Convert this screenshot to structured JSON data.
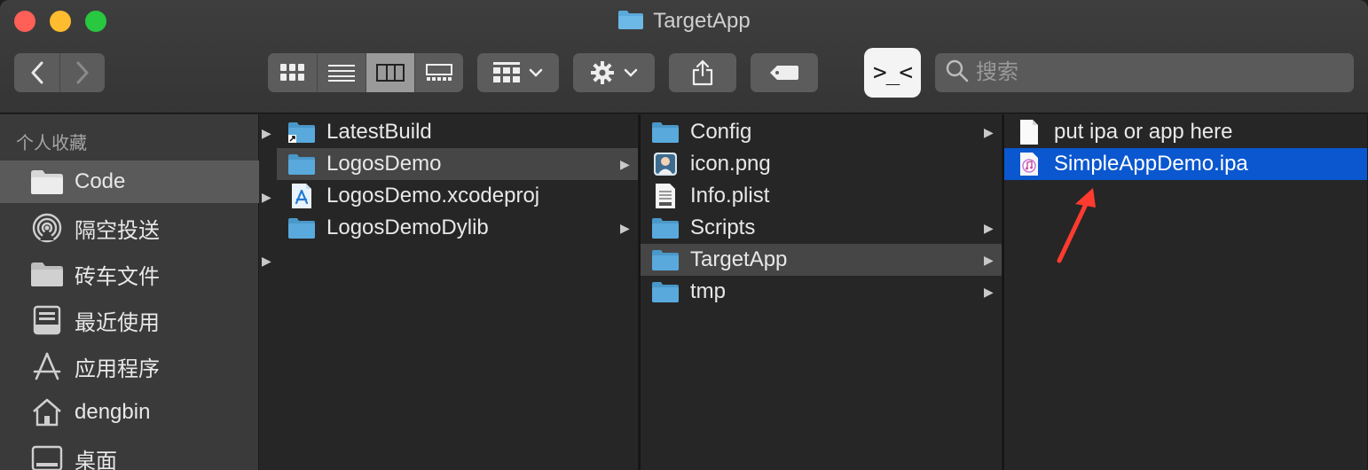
{
  "window": {
    "title": "TargetApp"
  },
  "toolbar": {
    "search_placeholder": "搜索",
    "terminal_label": ">_<"
  },
  "sidebar": {
    "section_title": "个人收藏",
    "items": [
      {
        "label": "Code",
        "icon": "folder-icon",
        "selected": true
      },
      {
        "label": "隔空投送",
        "icon": "airdrop-icon"
      },
      {
        "label": "砖车文件",
        "icon": "folder-icon"
      },
      {
        "label": "最近使用",
        "icon": "recents-icon"
      },
      {
        "label": "应用程序",
        "icon": "applications-icon"
      },
      {
        "label": "dengbin",
        "icon": "home-icon"
      },
      {
        "label": "桌面",
        "icon": "desktop-icon"
      }
    ]
  },
  "columns": [
    {
      "items": [
        {
          "label": "LatestBuild",
          "icon": "folder-alias-icon",
          "expandable": false
        },
        {
          "label": "LogosDemo",
          "icon": "folder-icon",
          "expandable": true,
          "state": "highlighted"
        },
        {
          "label": "LogosDemo.xcodeproj",
          "icon": "xcodeproj-icon",
          "expandable": false
        },
        {
          "label": "LogosDemoDylib",
          "icon": "folder-icon",
          "expandable": true
        }
      ]
    },
    {
      "items": [
        {
          "label": "Config",
          "icon": "folder-icon",
          "expandable": true
        },
        {
          "label": "icon.png",
          "icon": "png-icon",
          "expandable": false
        },
        {
          "label": "Info.plist",
          "icon": "plist-icon",
          "expandable": false
        },
        {
          "label": "Scripts",
          "icon": "folder-icon",
          "expandable": true
        },
        {
          "label": "TargetApp",
          "icon": "folder-icon",
          "expandable": true,
          "state": "highlighted"
        },
        {
          "label": "tmp",
          "icon": "folder-icon",
          "expandable": true
        }
      ]
    },
    {
      "items": [
        {
          "label": "put ipa or app here",
          "icon": "document-icon",
          "expandable": false
        },
        {
          "label": "SimpleAppDemo.ipa",
          "icon": "ipa-icon",
          "expandable": false,
          "state": "selected"
        }
      ]
    }
  ],
  "colors": {
    "selection": "#0a57cf",
    "annotation_arrow": "#ff3b30",
    "folder": "#5aa9dc"
  }
}
